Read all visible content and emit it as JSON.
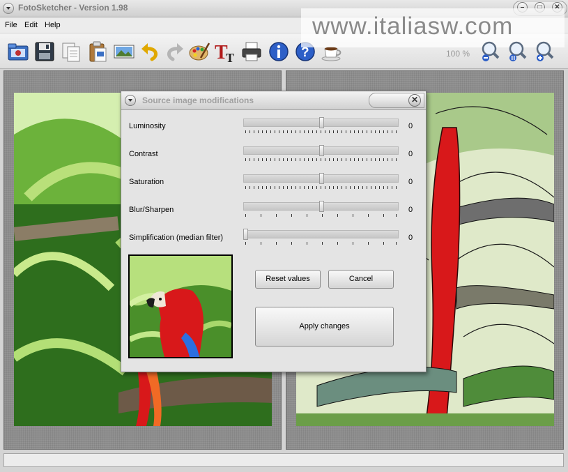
{
  "window": {
    "title": "FotoSketcher - Version 1.98"
  },
  "watermark": "www.italiasw.com",
  "menu": [
    "File",
    "Edit",
    "Help"
  ],
  "toolbar": {
    "icons": [
      "open-folder-icon",
      "save-icon",
      "copy-icon",
      "paste-icon",
      "image-icon",
      "undo-icon",
      "redo-icon",
      "palette-icon",
      "text-icon",
      "print-icon",
      "info-icon",
      "help-icon",
      "coffee-icon"
    ],
    "zoom_label": "100 %",
    "zoom_icons": [
      "zoom-out-icon",
      "zoom-actual-icon",
      "zoom-in-icon"
    ]
  },
  "dialog": {
    "title": "Source image modifications",
    "sliders": [
      {
        "label": "Luminosity",
        "value": "0",
        "position": 0.5
      },
      {
        "label": "Contrast",
        "value": "0",
        "position": 0.5
      },
      {
        "label": "Saturation",
        "value": "0",
        "position": 0.5
      },
      {
        "label": "Blur/Sharpen",
        "value": "0",
        "position": 0.5
      },
      {
        "label": "Simplification (median filter)",
        "value": "0",
        "position": 0.0
      }
    ],
    "buttons": {
      "reset": "Reset values",
      "cancel": "Cancel",
      "apply": "Apply changes"
    }
  },
  "colors": {
    "parrot_red": "#d8181a",
    "foliage_green": "#3f8f24",
    "light_leaf": "#b9e07a"
  }
}
